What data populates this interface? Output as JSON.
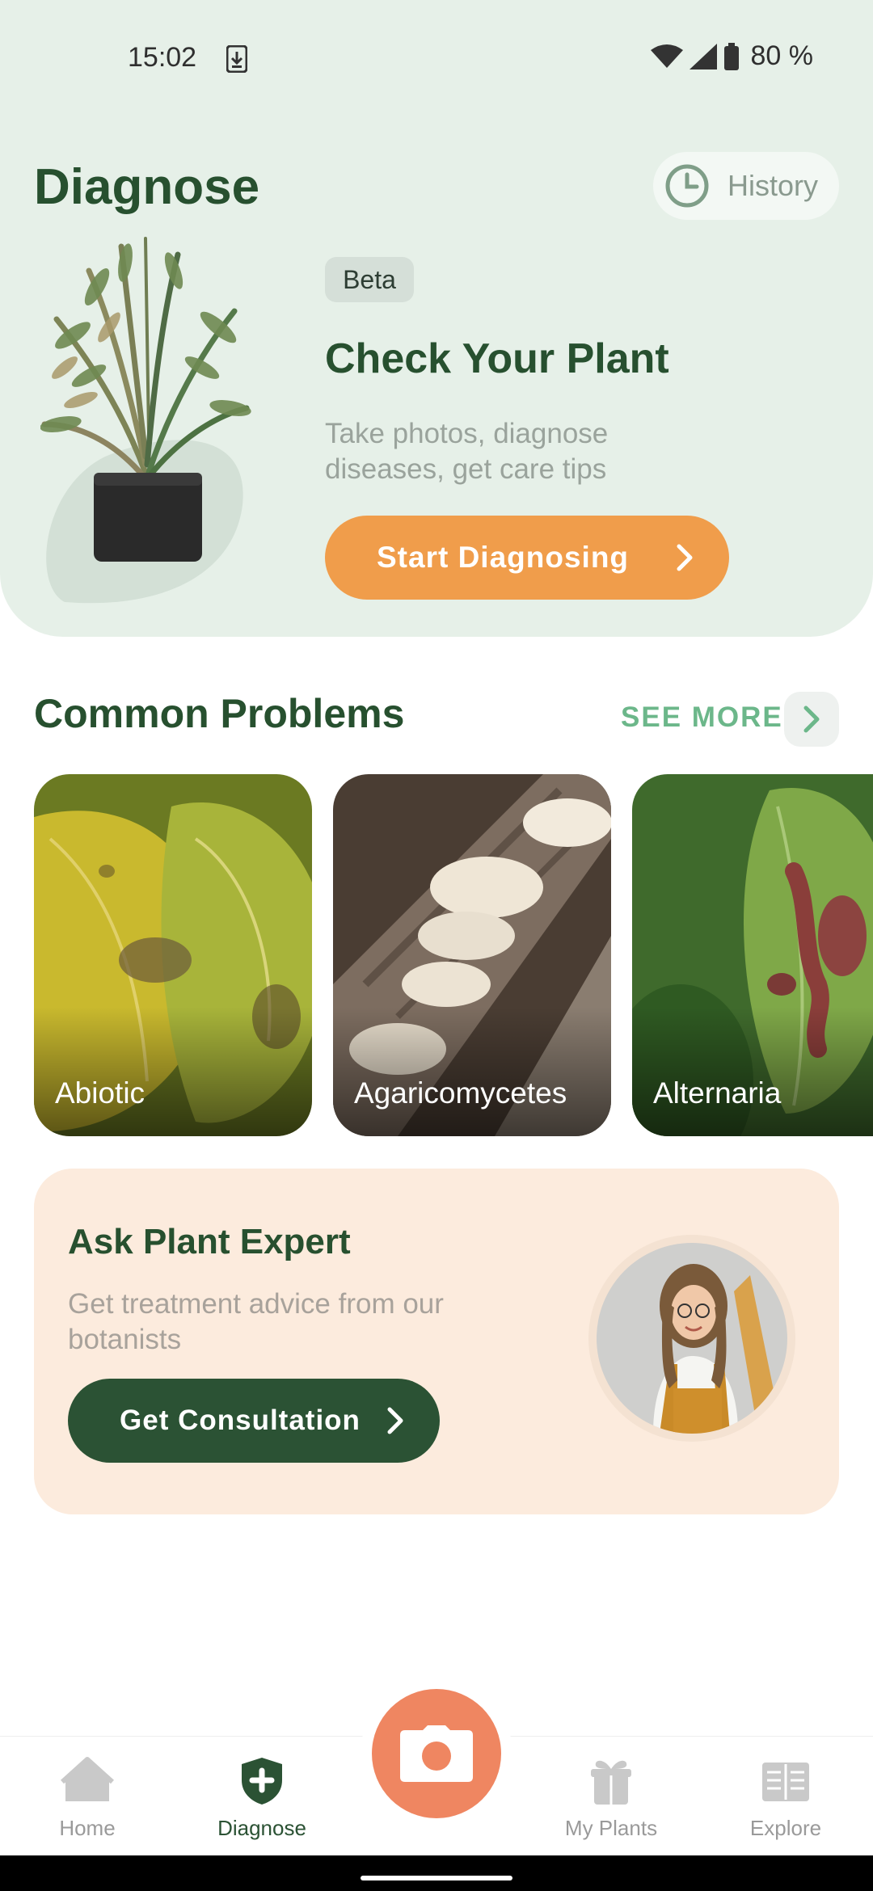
{
  "status_bar": {
    "time": "15:02",
    "battery": "80 %"
  },
  "header": {
    "title": "Diagnose",
    "history_label": "History"
  },
  "hero": {
    "badge": "Beta",
    "title": "Check Your Plant",
    "subtitle": "Take photos, diagnose diseases, get care tips",
    "cta_label": "Start Diagnosing"
  },
  "common_problems": {
    "title": "Common Problems",
    "see_more_label": "SEE MORE",
    "items": [
      {
        "label": "Abiotic"
      },
      {
        "label": "Agaricomycetes"
      },
      {
        "label": "Alternaria"
      }
    ]
  },
  "expert": {
    "title": "Ask Plant Expert",
    "subtitle": "Get treatment advice from our botanists",
    "cta_label": "Get Consultation"
  },
  "bottom_nav": {
    "items": [
      {
        "label": "Home",
        "icon": "home-icon",
        "active": false
      },
      {
        "label": "Diagnose",
        "icon": "shield-plus-icon",
        "active": true
      },
      {
        "label": "My Plants",
        "icon": "gift-plant-icon",
        "active": false
      },
      {
        "label": "Explore",
        "icon": "book-icon",
        "active": false
      }
    ],
    "camera_icon": "camera-icon"
  },
  "colors": {
    "primary_green": "#27502f",
    "accent_orange": "#f09d4b",
    "camera_coral": "#ef8661",
    "hero_bg": "#e6f0e8",
    "expert_bg": "#fcebdd"
  }
}
